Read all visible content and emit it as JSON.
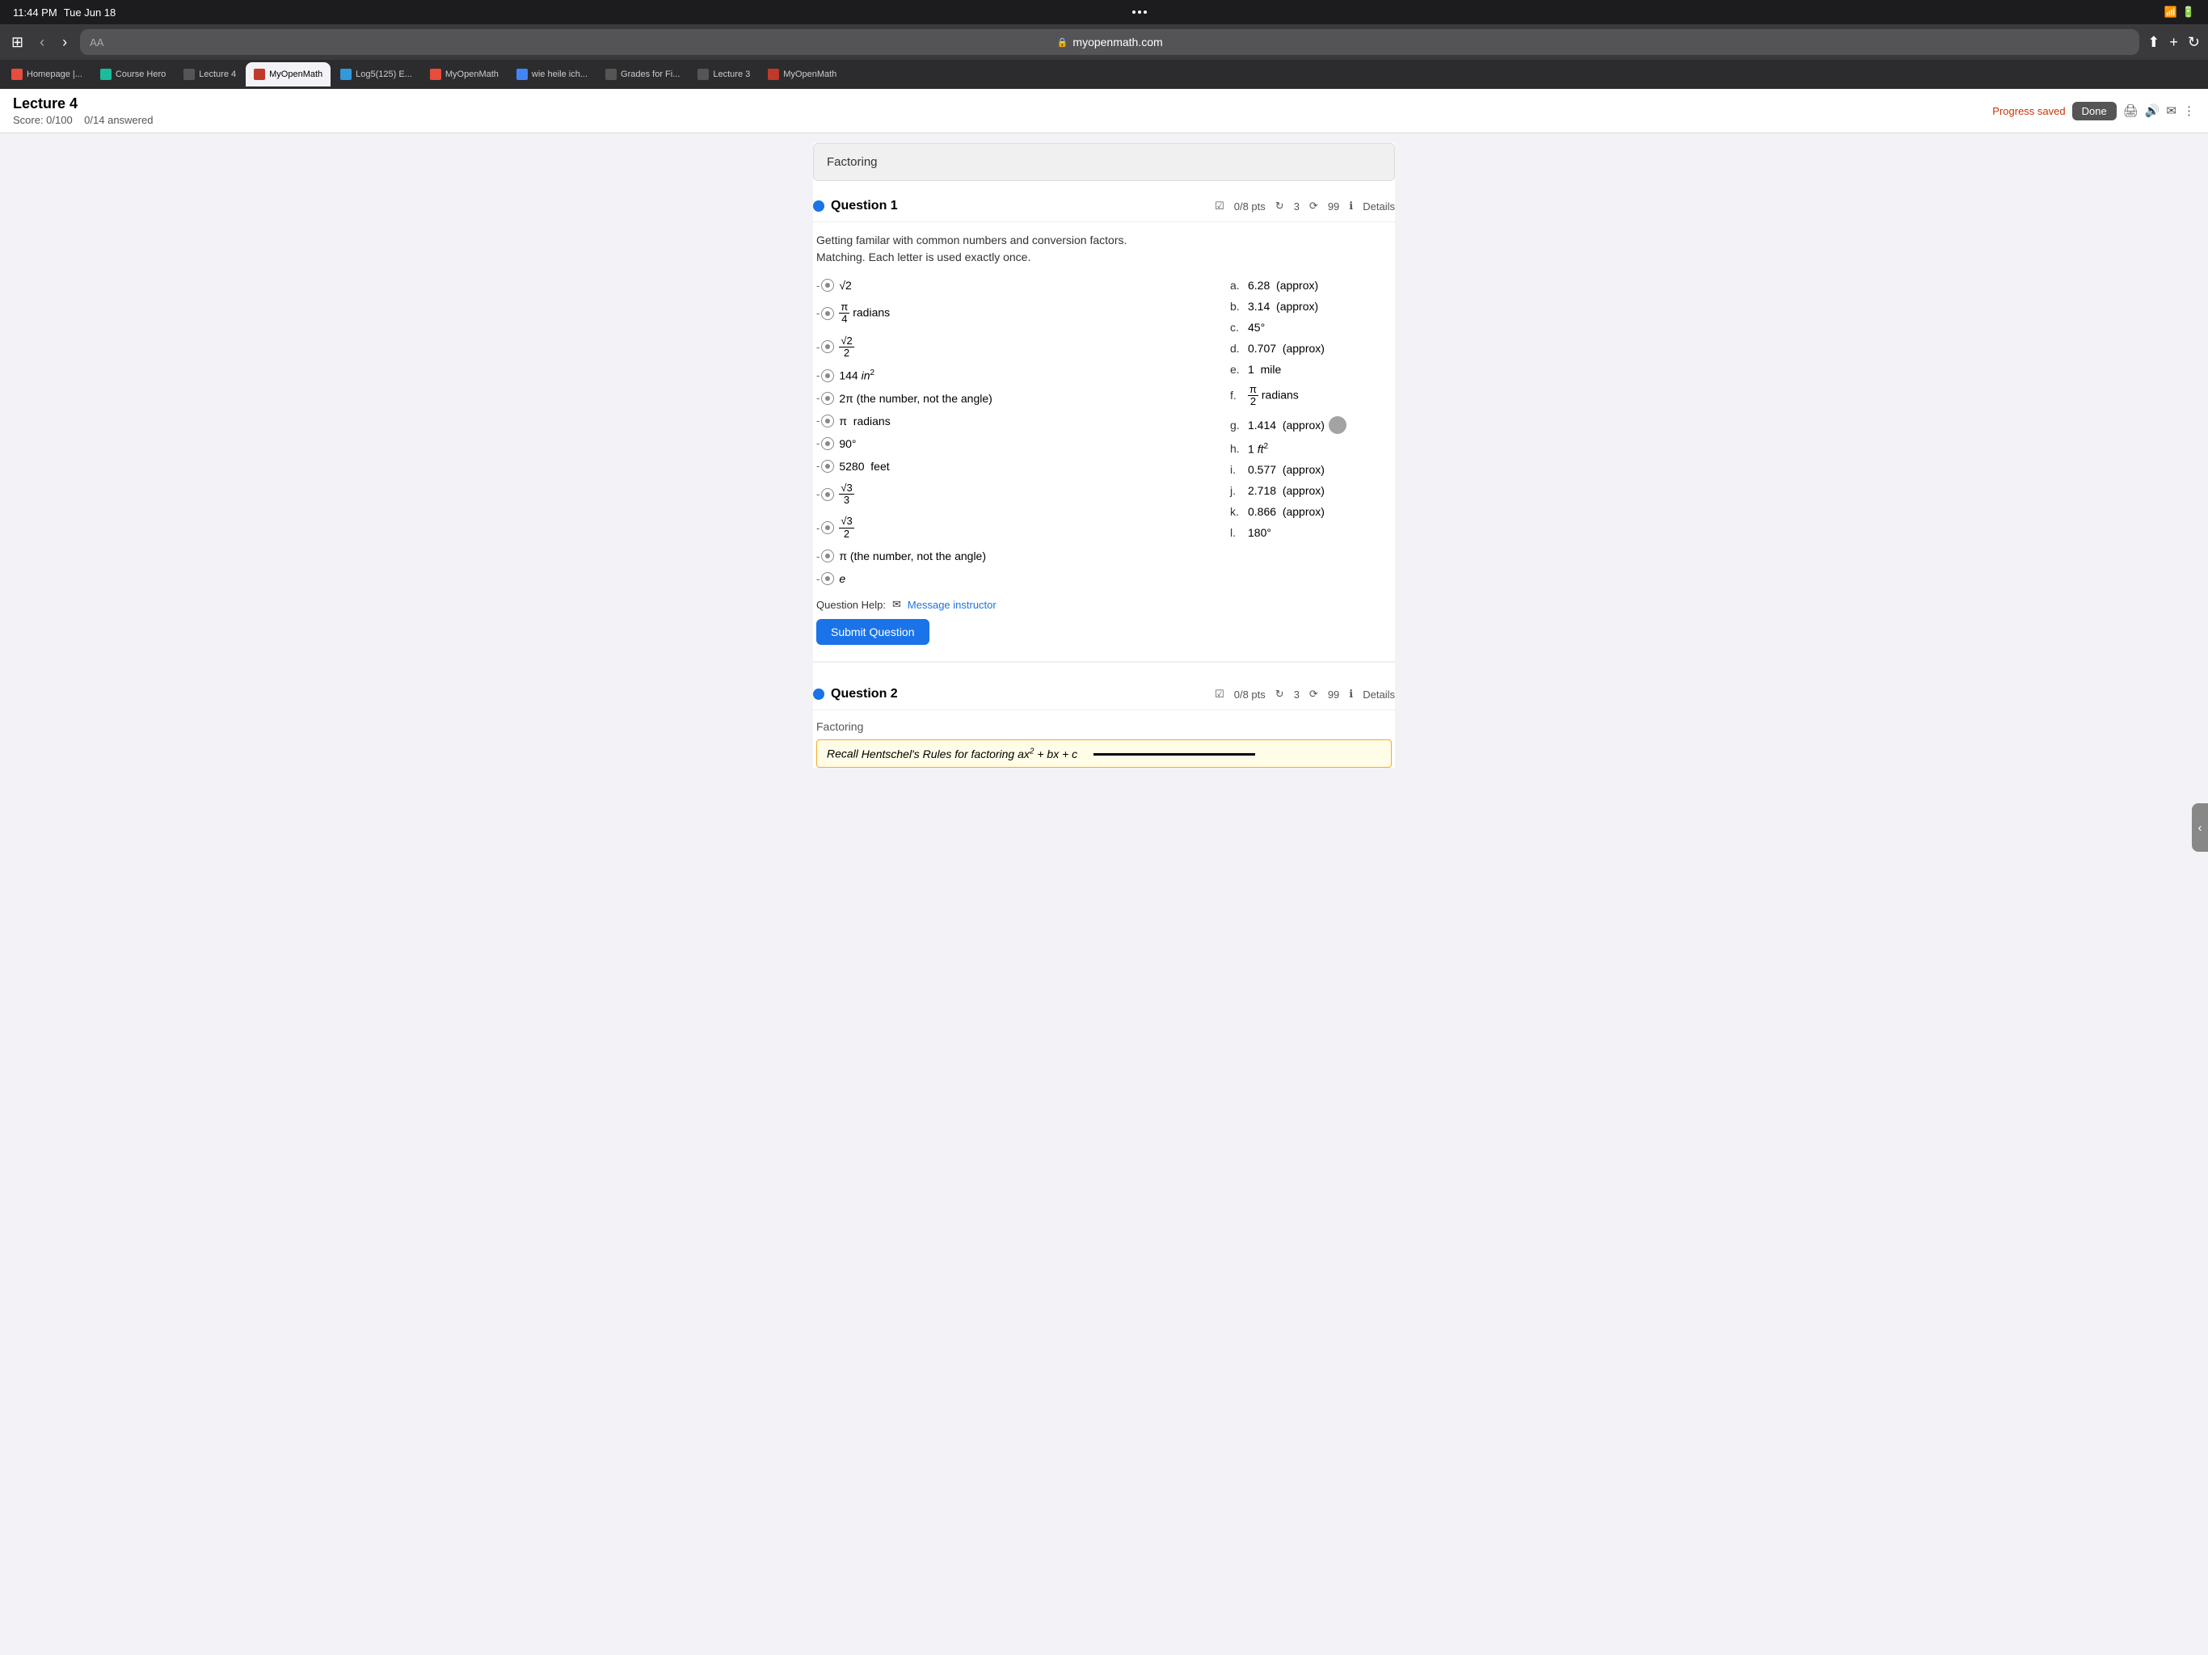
{
  "status_bar": {
    "time": "11:44 PM",
    "date": "Tue Jun 18",
    "wifi": "WiFi",
    "battery": "Charging"
  },
  "browser": {
    "aa_label": "AA",
    "url": "myopenmath.com",
    "tabs": [
      {
        "id": "homepage",
        "label": "Homepage |...",
        "favicon_color": "#e74c3c",
        "active": false
      },
      {
        "id": "coursehero",
        "label": "Course Hero",
        "favicon_color": "#1abc9c",
        "active": false
      },
      {
        "id": "lecture4",
        "label": "Lecture 4",
        "favicon_color": "#555",
        "active": false
      },
      {
        "id": "myopenmath1",
        "label": "MyOpenMath",
        "favicon_color": "#c0392b",
        "active": true
      },
      {
        "id": "log5",
        "label": "Log5(125) E...",
        "favicon_color": "#3498db",
        "active": false
      },
      {
        "id": "myopenmath2",
        "label": "MyOpenMath",
        "favicon_color": "#e74c3c",
        "active": false
      },
      {
        "id": "google",
        "label": "wie heile ich...",
        "favicon_color": "#4285f4",
        "active": false
      },
      {
        "id": "grades",
        "label": "Grades for Fi...",
        "favicon_color": "#555",
        "active": false
      },
      {
        "id": "lecture3",
        "label": "Lecture 3",
        "favicon_color": "#555",
        "active": false
      },
      {
        "id": "myopenmath3",
        "label": "MyOpenMath",
        "favicon_color": "#c0392b",
        "active": false
      }
    ]
  },
  "page": {
    "title": "Lecture 4",
    "score": "Score: 0/100",
    "answered": "0/14 answered",
    "progress_saved": "Progress saved",
    "done_label": "Done",
    "section_label": "Factoring",
    "question1": {
      "label": "Question 1",
      "pts": "0/8 pts",
      "retries": "3",
      "attempts": "99",
      "details": "Details",
      "description_line1": "Getting familar with common numbers and conversion factors.",
      "description_line2": "Matching. Each letter is used exactly once.",
      "left_items": [
        {
          "id": "sqrt2",
          "text": "√2"
        },
        {
          "id": "pi4",
          "text": "π/4 radians"
        },
        {
          "id": "sqrt2_2",
          "text": "√2/2"
        },
        {
          "id": "144in2",
          "text": "144 in²"
        },
        {
          "id": "2pi",
          "text": "2π (the number, not the angle)"
        },
        {
          "id": "pi_rad",
          "text": "π  radians"
        },
        {
          "id": "90deg",
          "text": "90°"
        },
        {
          "id": "5280",
          "text": "5280  feet"
        },
        {
          "id": "sqrt3_3",
          "text": "√3/3"
        },
        {
          "id": "sqrt3_2",
          "text": "√3/2"
        },
        {
          "id": "pi_num",
          "text": "π (the number, not the angle)"
        },
        {
          "id": "e",
          "text": "e"
        }
      ],
      "right_items": [
        {
          "letter": "a.",
          "value": "6.28  (approx)"
        },
        {
          "letter": "b.",
          "value": "3.14  (approx)"
        },
        {
          "letter": "c.",
          "value": "45°"
        },
        {
          "letter": "d.",
          "value": "0.707  (approx)"
        },
        {
          "letter": "e.",
          "value": "1  mile"
        },
        {
          "letter": "f.",
          "value": "π/2 radians"
        },
        {
          "letter": "g.",
          "value": "1.414  (approx)"
        },
        {
          "letter": "h.",
          "value": "1 ft²"
        },
        {
          "letter": "i.",
          "value": "0.577  (approx)"
        },
        {
          "letter": "j.",
          "value": "2.718  (approx)"
        },
        {
          "letter": "k.",
          "value": "0.866  (approx)"
        },
        {
          "letter": "l.",
          "value": "180°"
        }
      ],
      "help_label": "Question Help:",
      "message_instructor": "Message instructor",
      "submit_label": "Submit Question"
    },
    "question2": {
      "label": "Question 2",
      "pts": "0/8 pts",
      "retries": "3",
      "attempts": "99",
      "details": "Details",
      "section": "Factoring",
      "recall_text": "Recall Hentschel's Rules for factoring ax² + bx + c"
    }
  }
}
